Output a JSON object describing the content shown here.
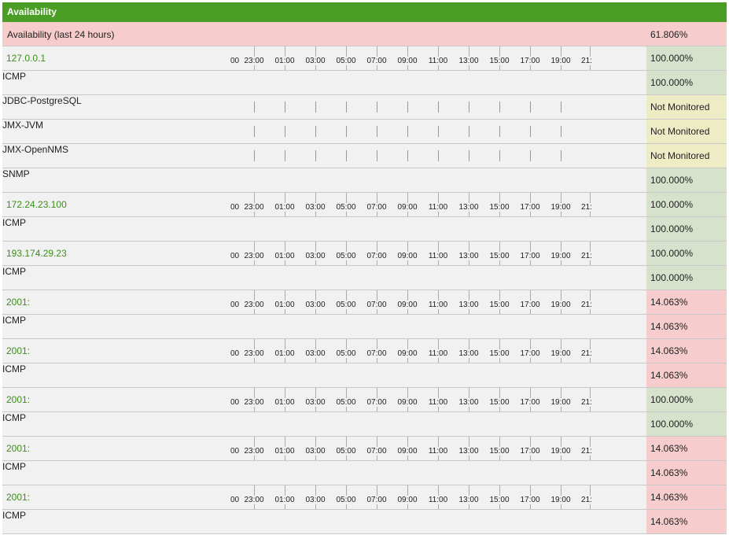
{
  "header": {
    "title": "Availability"
  },
  "summary": {
    "label": "Availability (last 24 hours)",
    "value": "61.806%"
  },
  "axis_labels": [
    "00",
    "23:00",
    "01:00",
    "03:00",
    "05:00",
    "07:00",
    "09:00",
    "11:00",
    "13:00",
    "15:00",
    "17:00",
    "19:00",
    "21:"
  ],
  "colors": {
    "header": "#4a9d25",
    "up": "#9cc472",
    "down": "#e25f5f",
    "ok_bg": "#d7e2cc",
    "warn_bg": "#eeecc4",
    "bad_bg": "#f6cccc",
    "ok_stripe": "#7ab34c",
    "warn_stripe": "#e8e5a8",
    "bad_stripe": "#e25050",
    "link": "#3d8e1c"
  },
  "rows": [
    {
      "type": "node",
      "label": "127.0.0.1",
      "value": "100.000%",
      "status": "ok"
    },
    {
      "type": "service",
      "label": "ICMP",
      "value": "100.000%",
      "status": "ok",
      "availability": 1.0
    },
    {
      "type": "service",
      "label": "JDBC-PostgreSQL",
      "value": "Not Monitored",
      "status": "warn",
      "availability": null
    },
    {
      "type": "service",
      "label": "JMX-JVM",
      "value": "Not Monitored",
      "status": "warn",
      "availability": null
    },
    {
      "type": "service",
      "label": "JMX-OpenNMS",
      "value": "Not Monitored",
      "status": "warn",
      "availability": null
    },
    {
      "type": "service",
      "label": "SNMP",
      "value": "100.000%",
      "status": "ok",
      "availability": 1.0
    },
    {
      "type": "node",
      "label": "172.24.23.100",
      "value": "100.000%",
      "status": "ok"
    },
    {
      "type": "service",
      "label": "ICMP",
      "value": "100.000%",
      "status": "ok",
      "availability": 1.0
    },
    {
      "type": "node",
      "label": "193.174.29.23",
      "value": "100.000%",
      "status": "ok"
    },
    {
      "type": "service",
      "label": "ICMP",
      "value": "100.000%",
      "status": "ok",
      "availability": 1.0
    },
    {
      "type": "node",
      "label": "2001:",
      "value": "14.063%",
      "status": "bad"
    },
    {
      "type": "service",
      "label": "ICMP",
      "value": "14.063%",
      "status": "bad",
      "availability": 0.14063
    },
    {
      "type": "node",
      "label": "2001:",
      "value": "14.063%",
      "status": "bad"
    },
    {
      "type": "service",
      "label": "ICMP",
      "value": "14.063%",
      "status": "bad",
      "availability": 0.14063
    },
    {
      "type": "node",
      "label": "2001:",
      "value": "100.000%",
      "status": "ok"
    },
    {
      "type": "service",
      "label": "ICMP",
      "value": "100.000%",
      "status": "ok",
      "availability": 1.0
    },
    {
      "type": "node",
      "label": "2001:",
      "value": "14.063%",
      "status": "bad"
    },
    {
      "type": "service",
      "label": "ICMP",
      "value": "14.063%",
      "status": "bad",
      "availability": 0.14063
    },
    {
      "type": "node",
      "label": "2001:",
      "value": "14.063%",
      "status": "bad"
    },
    {
      "type": "service",
      "label": "ICMP",
      "value": "14.063%",
      "status": "bad",
      "availability": 0.14063
    }
  ]
}
